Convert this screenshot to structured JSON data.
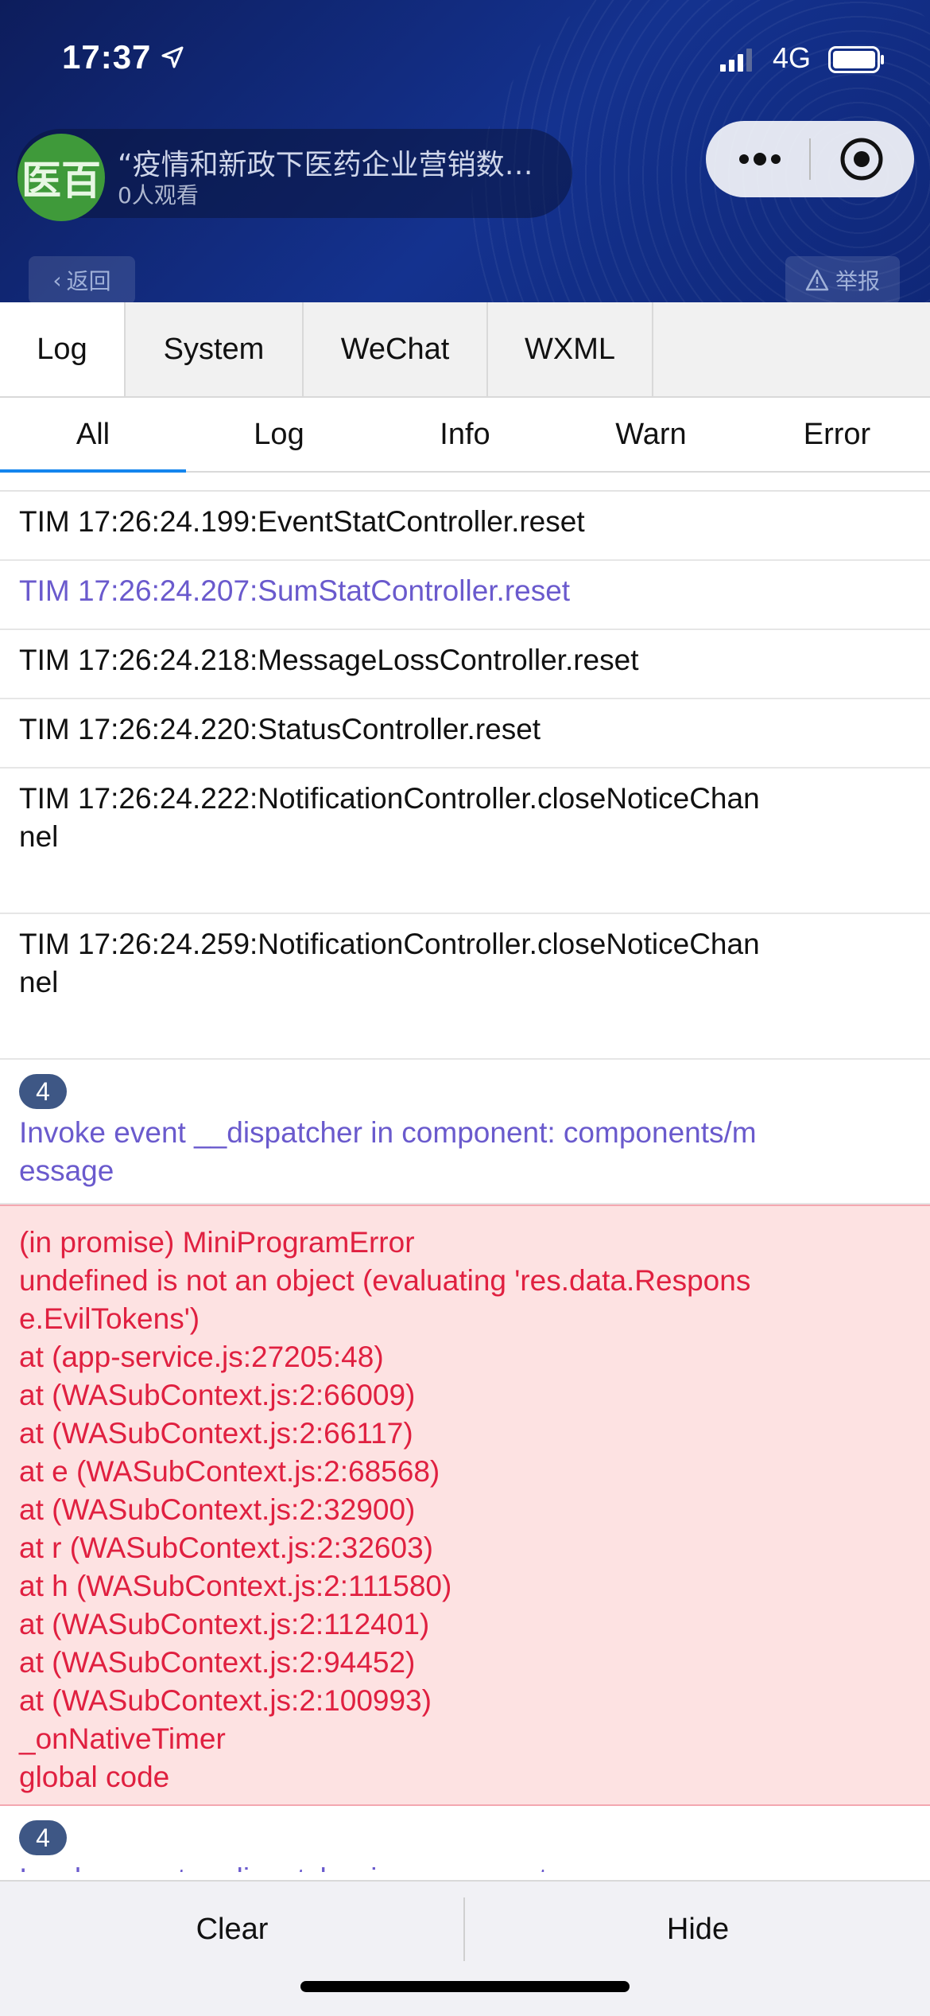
{
  "status_bar": {
    "time": "17:37",
    "carrier": "4G"
  },
  "live": {
    "avatar_text": "医百",
    "title": "“疫情和新政下医药企业营销数…",
    "viewers": "0人观看"
  },
  "header_buttons": {
    "back": "返回",
    "report": "举报"
  },
  "console": {
    "tabs": [
      {
        "label": "Log"
      },
      {
        "label": "System"
      },
      {
        "label": "WeChat"
      },
      {
        "label": "WXML"
      }
    ],
    "subtabs": [
      {
        "label": "All"
      },
      {
        "label": "Log"
      },
      {
        "label": "Info"
      },
      {
        "label": "Warn"
      },
      {
        "label": "Error"
      }
    ],
    "logs": {
      "l1": "TIM 17:26:24.199:EventStatController.reset",
      "l2": "TIM 17:26:24.207:SumStatController.reset",
      "l3": "TIM 17:26:24.218:MessageLossController.reset",
      "l4": "TIM 17:26:24.220:StatusController.reset",
      "l5": "TIM 17:26:24.222:NotificationController.closeNoticeChannel",
      "l6": "TIM 17:26:24.259:NotificationController.closeNoticeChannel",
      "l7_badge": "4",
      "l7": "Invoke event __dispatcher in component: components/message",
      "err": [
        "(in promise) MiniProgramError",
        "undefined is not an object (evaluating 'res.data.Response.EvilTokens')",
        "at (app-service.js:27205:48)",
        "at (WASubContext.js:2:66009)",
        "at (WASubContext.js:2:66117)",
        "at e (WASubContext.js:2:68568)",
        "at (WASubContext.js:2:32900)",
        "at r (WASubContext.js:2:32603)",
        "at h (WASubContext.js:2:111580)",
        "at (WASubContext.js:2:112401)",
        "at (WASubContext.js:2:94452)",
        "at (WASubContext.js:2:100993)",
        "_onNativeTimer",
        "global code"
      ],
      "l9_badge": "4",
      "l9": "Invoke event __dispatcher in component:"
    },
    "footer": {
      "clear": "Clear",
      "hide": "Hide"
    }
  }
}
